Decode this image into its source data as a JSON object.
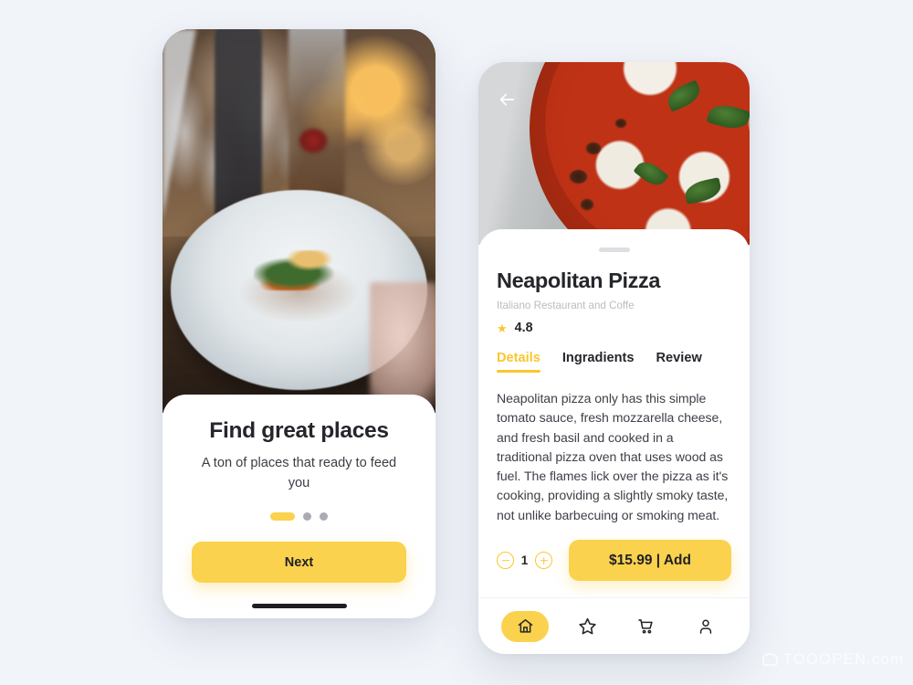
{
  "background_color": "#f1f4f9",
  "accent_color": "#fbd24e",
  "watermark": {
    "text": "TOOOPEN.com",
    "logo_icon": "cloud-icon"
  },
  "onboarding_screen": {
    "photo_alt": "restaurant table with plated gourmet dish, glassware and warm bokeh lights",
    "title": "Find great places",
    "subtitle": "A ton of places that ready to feed you",
    "pagination": {
      "total": 3,
      "active_index": 0
    },
    "next_button": "Next",
    "home_indicator": true
  },
  "detail_screen": {
    "hero_alt": "close-up of neapolitan margherita pizza with basil leaves on a marble counter",
    "back_icon": "arrow-left-icon",
    "drag_handle": true,
    "title": "Neapolitan Pizza",
    "subtitle": "Italiano Restaurant and Coffe",
    "rating": {
      "icon": "star-icon",
      "value": "4.8"
    },
    "tabs": [
      {
        "label": "Details",
        "active": true
      },
      {
        "label": "Ingradients",
        "active": false
      },
      {
        "label": "Review",
        "active": false
      }
    ],
    "description": "Neapolitan pizza only has this simple tomato sauce, fresh mozzarella cheese, and fresh basil and cooked in a traditional pizza oven that uses wood as fuel. The flames lick over the pizza as it's cooking, providing a slightly smoky taste, not unlike barbecuing or smoking meat.",
    "quantity": {
      "decrease_icon": "minus-circle-icon",
      "value": "1",
      "increase_icon": "plus-circle-icon"
    },
    "add_button": "$15.99 | Add",
    "bottom_nav": [
      {
        "icon": "home-icon",
        "active": true
      },
      {
        "icon": "star-icon",
        "active": false
      },
      {
        "icon": "cart-icon",
        "active": false
      },
      {
        "icon": "person-icon",
        "active": false
      }
    ]
  }
}
